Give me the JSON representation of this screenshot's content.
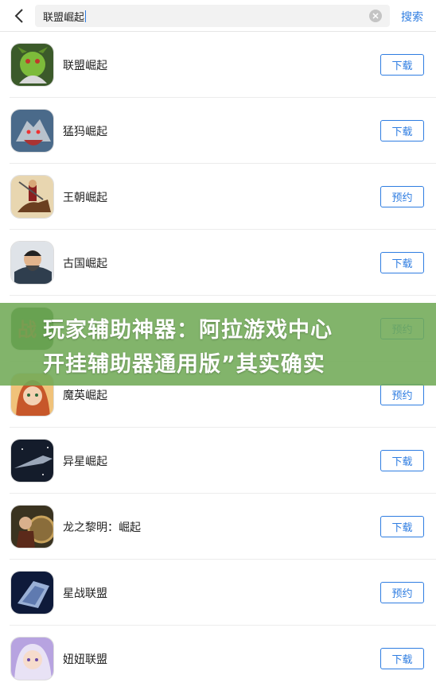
{
  "search": {
    "value": "联盟崛起",
    "action_label": "搜索"
  },
  "apps": [
    {
      "name": "联盟崛起",
      "button": "下载",
      "icon": "green-orc-icon"
    },
    {
      "name": "猛犸崛起",
      "button": "下载",
      "icon": "wolf-icon"
    },
    {
      "name": "王朝崛起",
      "button": "预约",
      "icon": "warrior-on-horse-icon"
    },
    {
      "name": "古国崛起",
      "button": "下载",
      "icon": "general-portrait-icon"
    },
    {
      "name": "",
      "button": "预约",
      "icon": "war-character-icon"
    },
    {
      "name": "魔英崛起",
      "button": "预约",
      "icon": "fantasy-girl-icon"
    },
    {
      "name": "异星崛起",
      "button": "下载",
      "icon": "spaceship-icon"
    },
    {
      "name": "龙之黎明：崛起",
      "button": "下载",
      "icon": "shield-warrior-icon"
    },
    {
      "name": "星战联盟",
      "button": "预约",
      "icon": "mech-icon"
    },
    {
      "name": "妞妞联盟",
      "button": "下载",
      "icon": "anime-girl-icon"
    }
  ],
  "banner": {
    "line1": "玩家辅助神器：阿拉游戏中心",
    "line2": "开挂辅助器通用版”其实确实"
  },
  "colors": {
    "accent": "#2f7de1",
    "banner": "#71aa56"
  }
}
